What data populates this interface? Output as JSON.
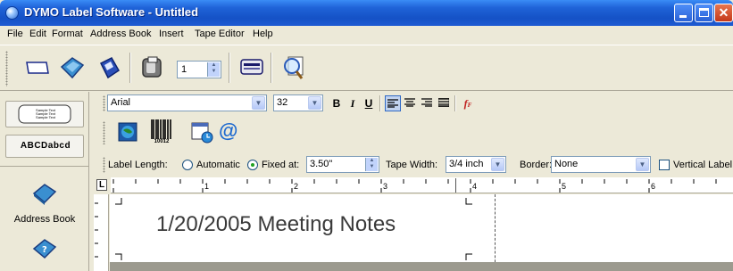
{
  "window": {
    "title": "DYMO Label Software - Untitled"
  },
  "menu": [
    "File",
    "Edit",
    "Format",
    "Address Book",
    "Insert",
    "Tape Editor",
    "Help"
  ],
  "toolbar": {
    "copies_value": "1"
  },
  "left_panel": {
    "label_preview_text": [
      "Sample Text",
      "Sample Text",
      "Sample Text"
    ],
    "tape_preview_text": "ABCDabcd",
    "address_book_label": "Address Book"
  },
  "format_bar": {
    "font_name": "Arial",
    "font_size": "32",
    "bold_label": "B",
    "italic_label": "I",
    "underline_label": "U",
    "fx_label": "f"
  },
  "insert_bar": {
    "barcode_caption": "10012",
    "at_symbol": "@"
  },
  "layout_bar": {
    "label_length_label": "Label Length:",
    "automatic_label": "Automatic",
    "fixed_at_label": "Fixed at:",
    "fixed_at_value": "3.50\"",
    "length_mode": "Fixed at",
    "tape_width_label": "Tape Width:",
    "tape_width_value": "3/4 inch",
    "border_label": "Border:",
    "border_value": "None",
    "vertical_label_label": "Vertical Label",
    "vertical_label_checked": false
  },
  "ruler": {
    "corner_label": "L",
    "numbers": [
      "1",
      "2",
      "3",
      "4",
      "5",
      "6"
    ]
  },
  "label": {
    "text": "1/20/2005 Meeting Notes"
  },
  "colors": {
    "titlebar": "#1f63d8",
    "chrome": "#ece9d8",
    "close": "#c4381a"
  }
}
